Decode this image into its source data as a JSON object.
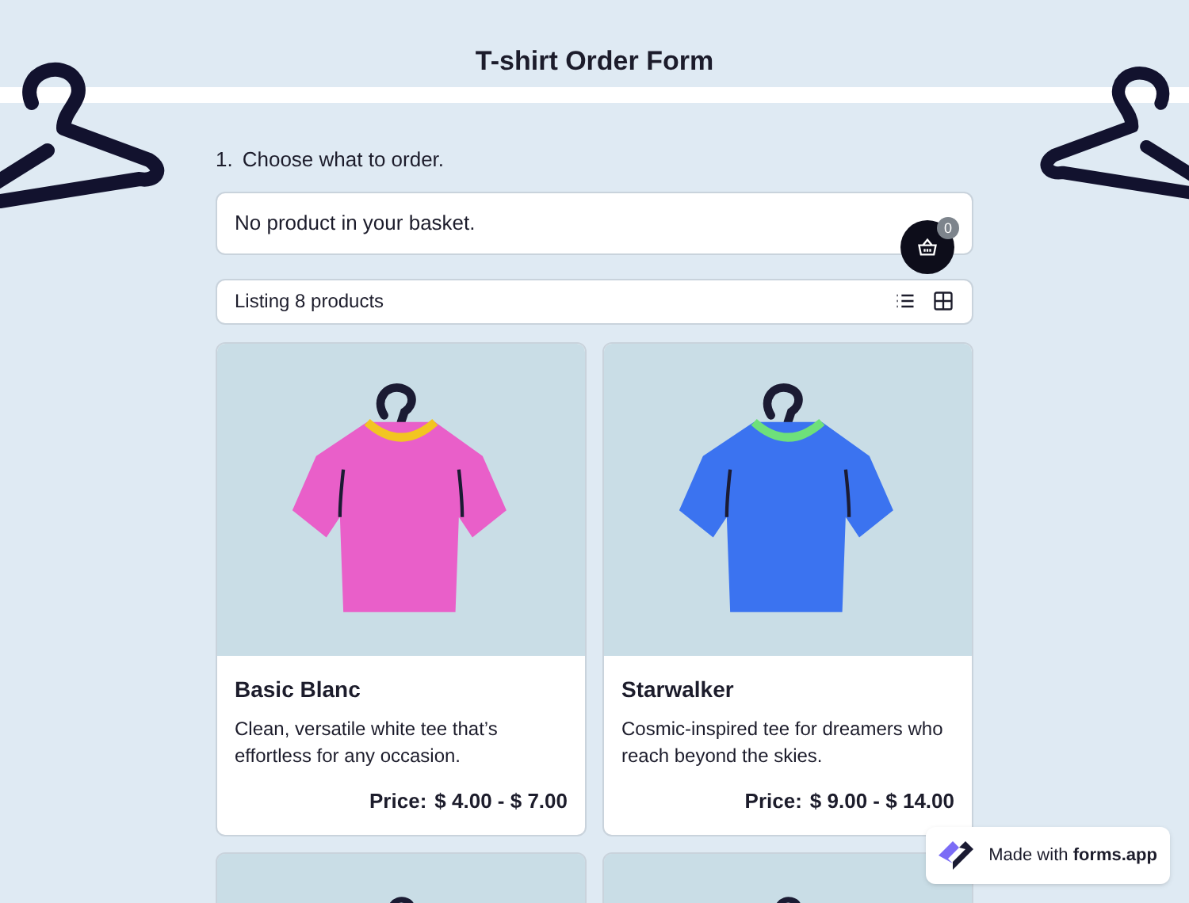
{
  "title": "T-shirt Order Form",
  "question": {
    "number": "1.",
    "label": "Choose what to order."
  },
  "basket": {
    "message": "No product in your basket.",
    "count": "0"
  },
  "listing": {
    "label": "Listing 8 products"
  },
  "products": [
    {
      "name": "Basic Blanc",
      "description": "Clean, versatile white tee that’s effortless for any occasion.",
      "price_label": "Price:",
      "price": "$ 4.00 - $ 7.00",
      "color": "#e95fc9",
      "collar": {
        "color": "#f2c521"
      }
    },
    {
      "name": "Starwalker",
      "description": "Cosmic-inspired tee for dreamers who reach beyond the skies.",
      "price_label": "Price:",
      "price": "$ 9.00 - $ 14.00",
      "color": "#3b73f0",
      "collar": {
        "color": "#6ee07a"
      }
    }
  ],
  "badge": {
    "prefix": "Made with",
    "brand": "forms.app"
  }
}
